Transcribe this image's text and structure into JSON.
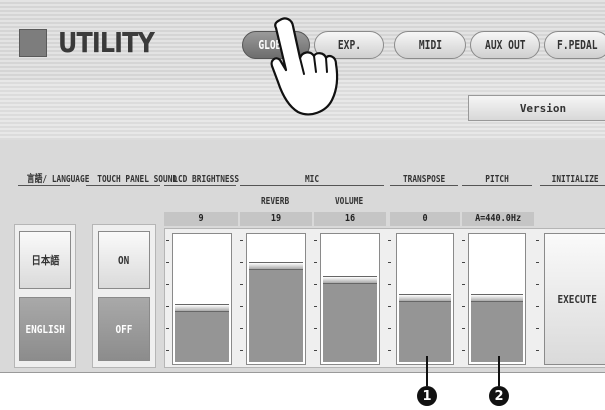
{
  "header": {
    "title": "UTILITY",
    "tabs": [
      {
        "label": "GLOBAL",
        "active": true
      },
      {
        "label": "EXP.",
        "active": false
      },
      {
        "label": "MIDI",
        "active": false
      },
      {
        "label": "AUX OUT",
        "active": false
      },
      {
        "label": "F.PEDAL",
        "active": false
      }
    ]
  },
  "version_button": "Version",
  "language": {
    "header": "言語/\nLANGUAGE",
    "options": [
      "日本語",
      "ENGLISH"
    ],
    "selected": "ENGLISH"
  },
  "touch_panel_sound": {
    "header": "TOUCH PANEL\nSOUND",
    "options": [
      "ON",
      "OFF"
    ],
    "selected": "OFF"
  },
  "lcd_brightness": {
    "header": "LCD\nBRIGHTNESS",
    "value": "9"
  },
  "mic": {
    "header": "MIC",
    "reverb": {
      "label": "REVERB",
      "value": "19"
    },
    "volume": {
      "label": "VOLUME",
      "value": "16"
    }
  },
  "transpose": {
    "header": "TRANSPOSE",
    "value": "0"
  },
  "pitch": {
    "header": "PITCH",
    "value": "A=440.0Hz"
  },
  "initialize": {
    "header": "INITIALIZE",
    "button": "EXECUTE"
  },
  "callouts": [
    "1",
    "2"
  ],
  "colors": {
    "screen_bg": "#d9d9d9",
    "fill": "#959595",
    "tab_active": "#7d7d7d"
  }
}
